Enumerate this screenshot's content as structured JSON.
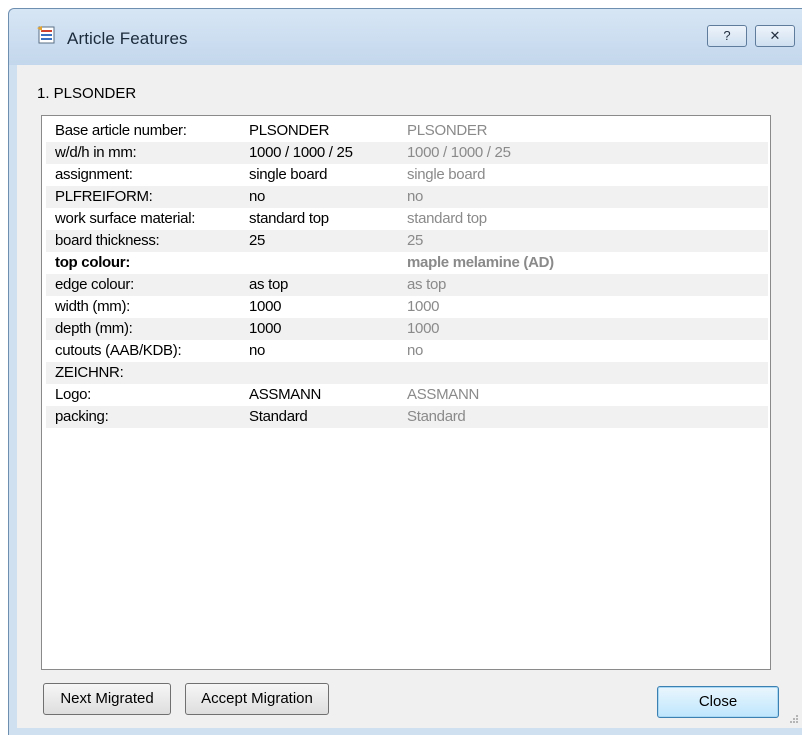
{
  "window": {
    "title": "Article Features",
    "help_label": "?",
    "close_label": "✕"
  },
  "heading": "1. PLSONDER",
  "rows": [
    {
      "label": "Base article number:",
      "value": "PLSONDER",
      "migrated": "PLSONDER"
    },
    {
      "label": "w/d/h in mm:",
      "value": "1000 / 1000 / 25",
      "migrated": "1000 / 1000 / 25"
    },
    {
      "label": "assignment:",
      "value": "single board",
      "migrated": "single board"
    },
    {
      "label": "PLFREIFORM:",
      "value": "no",
      "migrated": "no"
    },
    {
      "label": "work surface material:",
      "value": "standard top",
      "migrated": "standard top"
    },
    {
      "label": "board thickness:",
      "value": "25",
      "migrated": "25"
    },
    {
      "label": "top colour:",
      "value": "",
      "migrated": "maple melamine (AD)"
    },
    {
      "label": "edge colour:",
      "value": "as top",
      "migrated": "as top"
    },
    {
      "label": "width (mm):",
      "value": "1000",
      "migrated": "1000"
    },
    {
      "label": "depth (mm):",
      "value": "1000",
      "migrated": "1000"
    },
    {
      "label": "cutouts (AAB/KDB):",
      "value": "no",
      "migrated": "no"
    },
    {
      "label": "ZEICHNR:",
      "value": "",
      "migrated": ""
    },
    {
      "label": "Logo:",
      "value": "ASSMANN",
      "migrated": "ASSMANN"
    },
    {
      "label": "packing:",
      "value": "Standard",
      "migrated": "Standard"
    }
  ],
  "buttons": {
    "next_migrated": "Next Migrated",
    "accept_migration": "Accept Migration",
    "close": "Close"
  }
}
